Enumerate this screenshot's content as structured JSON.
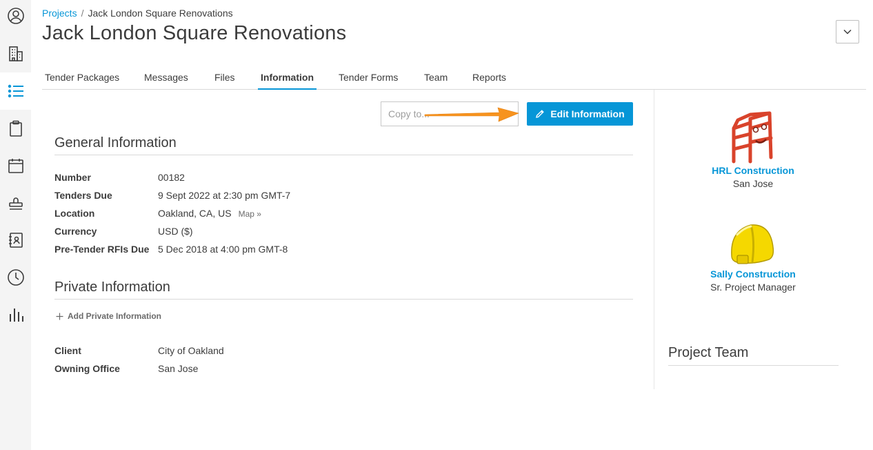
{
  "breadcrumb": {
    "root": "Projects",
    "separator": "/",
    "current": "Jack London Square Renovations"
  },
  "page_title": "Jack London Square Renovations",
  "sidebar": {
    "items": [
      {
        "icon": "user-circle-icon",
        "active": false
      },
      {
        "icon": "building-icon",
        "active": false
      },
      {
        "icon": "list-icon",
        "active": true
      },
      {
        "icon": "clipboard-icon",
        "active": false
      },
      {
        "icon": "calendar-icon",
        "active": false
      },
      {
        "icon": "stamp-icon",
        "active": false
      },
      {
        "icon": "contacts-book-icon",
        "active": false
      },
      {
        "icon": "clock-icon",
        "active": false
      },
      {
        "icon": "bar-chart-icon",
        "active": false
      }
    ]
  },
  "tabs": [
    {
      "label": "Tender Packages",
      "active": false
    },
    {
      "label": "Messages",
      "active": false
    },
    {
      "label": "Files",
      "active": false
    },
    {
      "label": "Information",
      "active": true
    },
    {
      "label": "Tender Forms",
      "active": false
    },
    {
      "label": "Team",
      "active": false
    },
    {
      "label": "Reports",
      "active": false
    }
  ],
  "toolbar": {
    "copy_placeholder": "Copy to...",
    "edit_label": "Edit Information"
  },
  "general": {
    "title": "General Information",
    "fields": [
      {
        "label": "Number",
        "value": "00182"
      },
      {
        "label": "Tenders Due",
        "value": "9 Sept 2022 at 2:30 pm GMT-7"
      },
      {
        "label": "Location",
        "value": "Oakland, CA, US",
        "link": "Map »"
      },
      {
        "label": "Currency",
        "value": "USD ($)"
      },
      {
        "label": "Pre-Tender RFIs Due",
        "value": "5 Dec 2018 at 4:00 pm GMT-8"
      }
    ]
  },
  "private": {
    "title": "Private Information",
    "add_label": "Add Private Information",
    "fields": [
      {
        "label": "Client",
        "value": "City of Oakland"
      },
      {
        "label": "Owning Office",
        "value": "San Jose"
      }
    ]
  },
  "companies": [
    {
      "name": "HRL Construction",
      "sub": "San Jose",
      "logo": "red-steel-frame-logo"
    },
    {
      "name": "Sally Construction",
      "sub": "Sr. Project Manager",
      "logo": "yellow-hard-hat-logo"
    }
  ],
  "project_team": {
    "title": "Project Team"
  },
  "colors": {
    "accent": "#0696d7",
    "annotation_arrow": "#f7931e",
    "logo_red": "#d9432b",
    "logo_yellow": "#f5d800"
  }
}
